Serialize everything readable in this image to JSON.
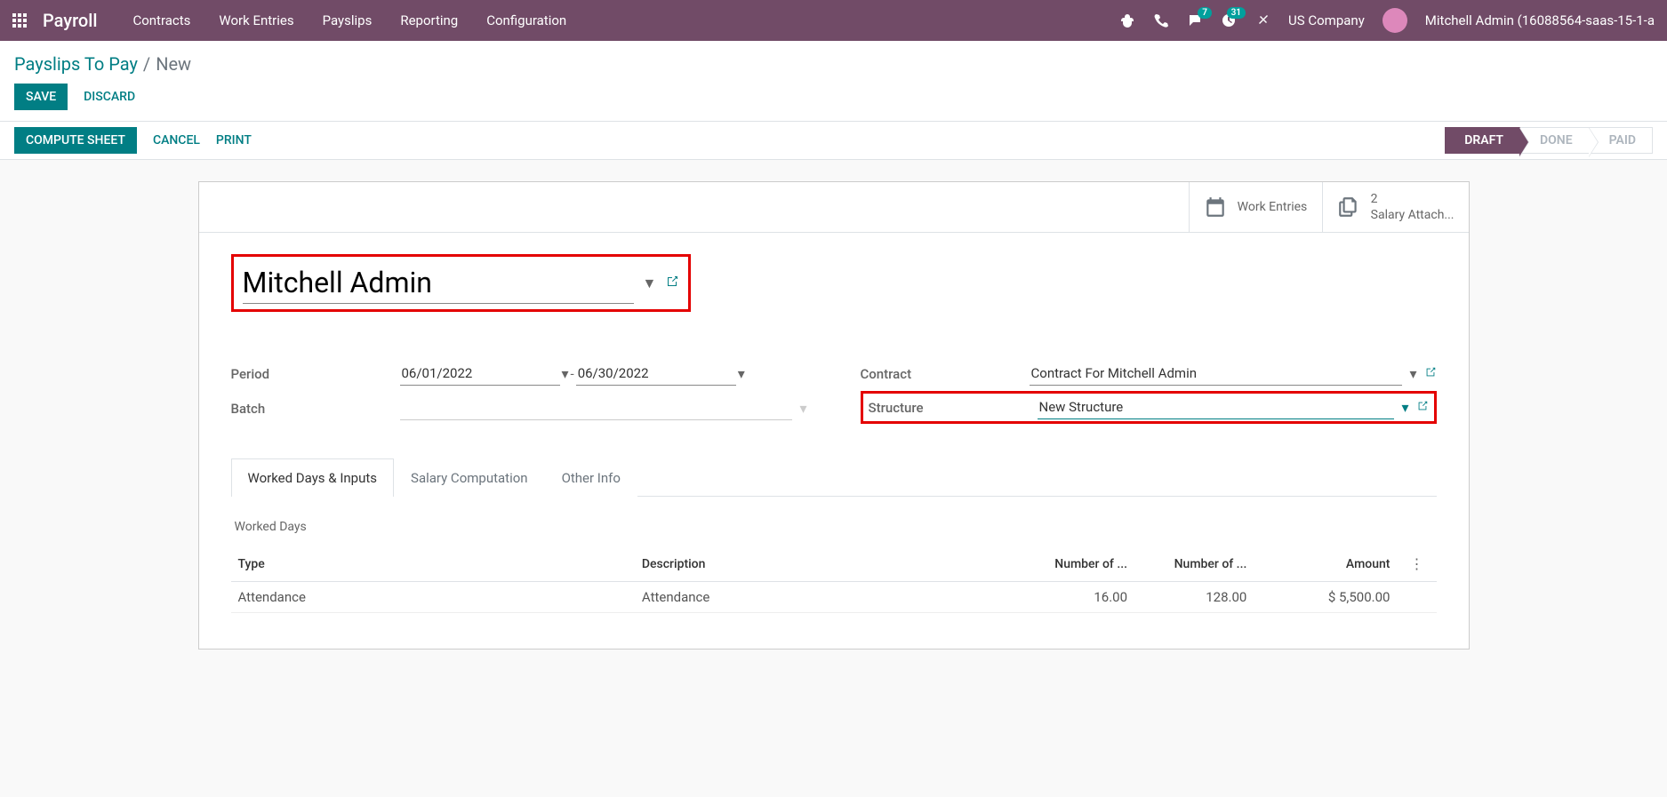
{
  "navbar": {
    "brand": "Payroll",
    "menu": [
      "Contracts",
      "Work Entries",
      "Payslips",
      "Reporting",
      "Configuration"
    ],
    "chat_badge": "7",
    "activity_badge": "31",
    "company": "US Company",
    "user": "Mitchell Admin (16088564-saas-15-1-a"
  },
  "breadcrumb": {
    "parent": "Payslips To Pay",
    "sep": "/",
    "current": "New"
  },
  "actions": {
    "save": "SAVE",
    "discard": "DISCARD"
  },
  "statusbar": {
    "compute": "COMPUTE SHEET",
    "cancel": "CANCEL",
    "print": "PRINT",
    "steps": {
      "draft": "DRAFT",
      "done": "DONE",
      "paid": "PAID"
    }
  },
  "button_box": {
    "work_entries": "Work Entries",
    "salary_attach_count": "2",
    "salary_attach": "Salary Attach..."
  },
  "form": {
    "employee": "Mitchell Admin",
    "labels": {
      "period": "Period",
      "batch": "Batch",
      "contract": "Contract",
      "structure": "Structure"
    },
    "period_from": "06/01/2022",
    "period_sep": "-",
    "period_to": "06/30/2022",
    "batch": "",
    "contract": "Contract For Mitchell Admin",
    "structure": "New Structure"
  },
  "tabs": {
    "worked": "Worked Days & Inputs",
    "salary": "Salary Computation",
    "other": "Other Info"
  },
  "worked_days": {
    "section": "Worked Days",
    "headers": {
      "type": "Type",
      "description": "Description",
      "num_days": "Number of ...",
      "num_hours": "Number of ...",
      "amount": "Amount"
    },
    "rows": [
      {
        "type": "Attendance",
        "description": "Attendance",
        "num_days": "16.00",
        "num_hours": "128.00",
        "amount": "$ 5,500.00"
      }
    ]
  }
}
